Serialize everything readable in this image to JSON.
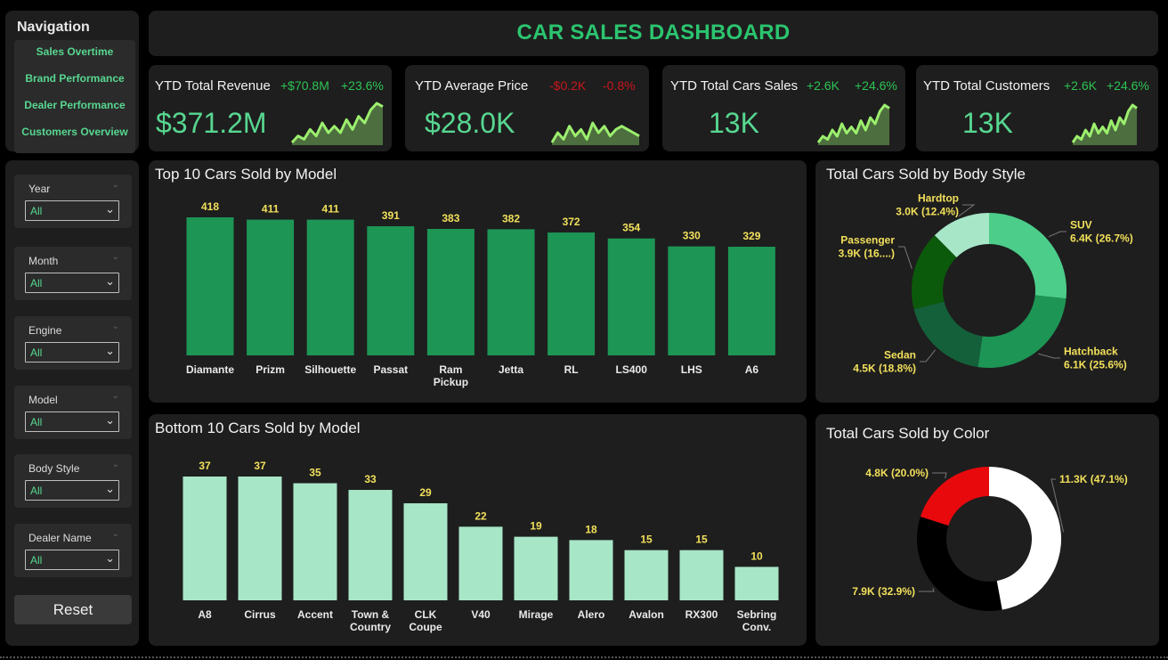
{
  "nav": {
    "title": "Navigation",
    "items": [
      "Sales Overtime",
      "Brand Performance",
      "Dealer Performance",
      "Customers Overview"
    ]
  },
  "filters": [
    {
      "label": "Year",
      "value": "All"
    },
    {
      "label": "Month",
      "value": "All"
    },
    {
      "label": "Engine",
      "value": "All"
    },
    {
      "label": "Model",
      "value": "All"
    },
    {
      "label": "Body Style",
      "value": "All"
    },
    {
      "label": "Dealer Name",
      "value": "All"
    }
  ],
  "reset_label": "Reset",
  "header": {
    "title": "CAR SALES DASHBOARD"
  },
  "kpis": [
    {
      "title": "YTD Total Revenue",
      "delta_abs": "+$70.8M",
      "delta_pct": "+23.6%",
      "value": "$371.2M",
      "trend": "up",
      "spark": [
        3,
        5,
        4,
        7,
        5,
        9,
        6,
        8,
        6,
        10,
        7,
        11,
        9,
        13,
        15,
        14
      ]
    },
    {
      "title": "YTD Average Price",
      "delta_abs": "-$0.2K",
      "delta_pct": "-0.8%",
      "value": "$28.0K",
      "trend": "down",
      "spark": [
        4,
        7,
        5,
        9,
        6,
        8,
        5,
        10,
        7,
        9,
        6,
        8,
        9,
        8,
        7,
        6
      ]
    },
    {
      "title": "YTD Total Cars Sales",
      "delta_abs": "+2.6K",
      "delta_pct": "+24.6%",
      "value": "13K",
      "trend": "up",
      "spark": [
        3,
        5,
        4,
        7,
        5,
        9,
        6,
        8,
        6,
        10,
        7,
        11,
        9,
        13,
        15,
        14
      ]
    },
    {
      "title": "YTD Total Customers",
      "delta_abs": "+2.6K",
      "delta_pct": "+24.6%",
      "value": "13K",
      "trend": "up",
      "spark": [
        3,
        5,
        4,
        7,
        5,
        9,
        6,
        8,
        6,
        10,
        7,
        11,
        9,
        13,
        15,
        14
      ]
    }
  ],
  "colors": {
    "positive": "#2dc453",
    "negative": "#c8171c",
    "accent": "#57d790",
    "top_bar": "#1d9555",
    "bottom_bar": "#a8e6c8"
  },
  "top10": {
    "title": "Top 10 Cars Sold by Model",
    "chart_data": {
      "type": "bar",
      "categories": [
        "Diamante",
        "Prizm",
        "Silhouette",
        "Passat",
        "Ram Pickup",
        "Jetta",
        "RL",
        "LS400",
        "LHS",
        "A6"
      ],
      "values": [
        418,
        411,
        411,
        391,
        383,
        382,
        372,
        354,
        330,
        329
      ]
    }
  },
  "bottom10": {
    "title": "Bottom 10 Cars Sold by Model",
    "chart_data": {
      "type": "bar",
      "categories": [
        "A8",
        "Cirrus",
        "Accent",
        "Town & Country",
        "CLK Coupe",
        "V40",
        "Mirage",
        "Alero",
        "Avalon",
        "RX300",
        "Sebring Conv."
      ],
      "values": [
        37,
        37,
        35,
        33,
        29,
        22,
        19,
        18,
        15,
        15,
        10
      ]
    }
  },
  "body_style": {
    "title": "Total Cars Sold by Body Style",
    "chart_data": {
      "type": "pie",
      "slices": [
        {
          "name": "SUV",
          "label": "6.4K (26.7%)",
          "value": 26.7,
          "color": "#4ccd8a"
        },
        {
          "name": "Hatchback",
          "label": "6.1K (25.6%)",
          "value": 25.6,
          "color": "#1d9555"
        },
        {
          "name": "Sedan",
          "label": "4.5K (18.8%)",
          "value": 18.8,
          "color": "#14603a"
        },
        {
          "name": "Passenger",
          "label": "3.9K (16....)",
          "value": 16.5,
          "color": "#0b5a0b"
        },
        {
          "name": "Hardtop",
          "label": "3.0K (12.4%)",
          "value": 12.4,
          "color": "#a8e6c8"
        }
      ]
    }
  },
  "by_color": {
    "title": "Total Cars Sold by Color",
    "chart_data": {
      "type": "pie",
      "slices": [
        {
          "label": "11.3K (47.1%)",
          "value": 47.1,
          "color": "#ffffff"
        },
        {
          "label": "7.9K (32.9%)",
          "value": 32.9,
          "color": "#000000"
        },
        {
          "label": "4.8K (20.0%)",
          "value": 20.0,
          "color": "#e8090d"
        }
      ]
    }
  }
}
